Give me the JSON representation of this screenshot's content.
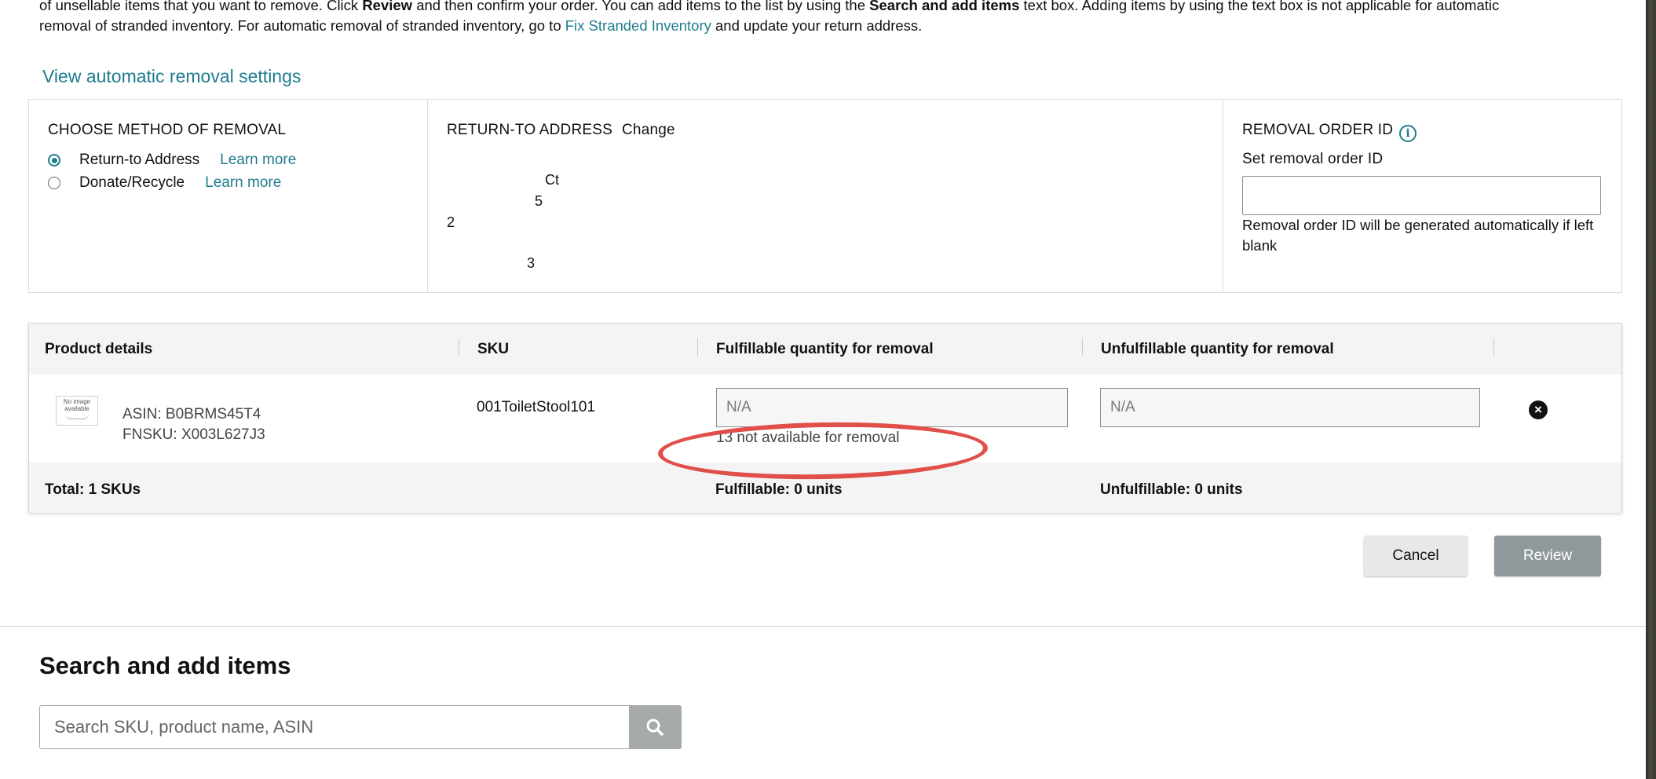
{
  "intro": {
    "line1_a": "of unsellable items that you want to remove. Click ",
    "line1_b": "Review",
    "line1_c": " and then confirm your order. You can add items to the list by using the ",
    "line1_d": "Search and add items",
    "line1_e": " text box. Adding items by using the text box is not applicable for automatic",
    "line2_a": "removal of stranded inventory. For automatic removal of stranded inventory, go to ",
    "line2_link": "Fix Stranded Inventory",
    "line2_b": " and update your return address."
  },
  "view_auto_settings": "View automatic removal settings",
  "method": {
    "heading": "CHOOSE METHOD OF REMOVAL",
    "options": [
      {
        "label": "Return-to Address",
        "learn_more": "Learn more",
        "selected": true
      },
      {
        "label": "Donate/Recycle",
        "learn_more": "Learn more",
        "selected": false
      }
    ]
  },
  "address": {
    "heading": "RETURN-TO ADDRESS",
    "change": "Change",
    "lines": [
      "Ct",
      "5",
      "2",
      "3"
    ]
  },
  "order_id": {
    "heading": "REMOVAL ORDER ID",
    "label": "Set removal order ID",
    "value": "",
    "note": "Removal order ID will be generated automatically if left blank"
  },
  "table": {
    "columns": [
      "Product details",
      "SKU",
      "Fulfillable quantity for removal",
      "Unfulfillable quantity for removal"
    ],
    "row": {
      "image_alt_line1": "No image",
      "image_alt_line2": "available",
      "asin": "ASIN: B0BRMS45T4",
      "fnsku": "FNSKU: X003L627J3",
      "sku": "001ToiletStool101",
      "fulfillable_placeholder": "N/A",
      "unfulfillable_placeholder": "N/A",
      "not_available": "13 not available for removal"
    },
    "footer": {
      "total": "Total: 1 SKUs",
      "fulfillable": "Fulfillable: 0 units",
      "unfulfillable": "Unfulfillable: 0 units"
    }
  },
  "buttons": {
    "cancel": "Cancel",
    "review": "Review"
  },
  "search": {
    "title": "Search and add items",
    "placeholder": "Search SKU, product name, ASIN"
  },
  "colors": {
    "link": "#1f7c8e",
    "annotation": "#e04f4a",
    "review_btn": "#8f999b"
  }
}
